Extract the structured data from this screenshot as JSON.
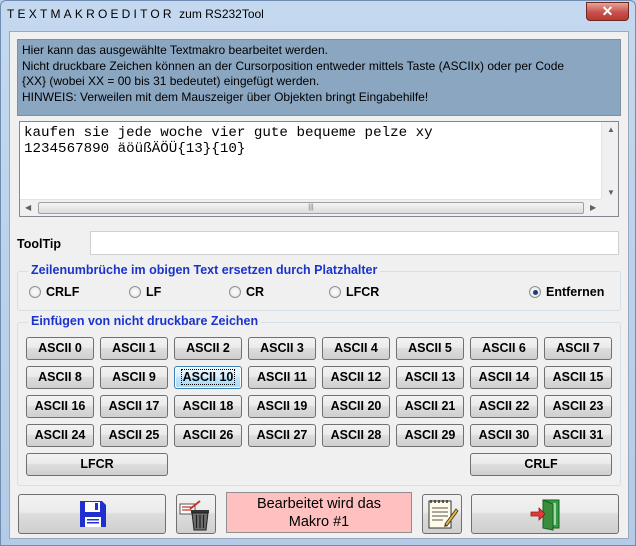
{
  "window": {
    "title_main": "TEXTMAKROEDITOR",
    "title_suffix": "zum RS232Tool",
    "close_label": "✕"
  },
  "info": {
    "lines": [
      "Hier kann das ausgewählte Textmakro bearbeitet werden.",
      "Nicht druckbare Zeichen können an der Cursorposition entweder mittels Taste (ASCIIx) oder per Code",
      "{XX} (wobei XX = 00 bis 31 bedeutet) eingefügt werden.",
      "HINWEIS: Verweilen mit dem Mauszeiger über Objekten bringt Eingabehilfe!"
    ]
  },
  "editor": {
    "line1": "kaufen sie jede woche vier gute bequeme pelze xy",
    "line2": "1234567890 äöüßÄÖÜ{13}{10}"
  },
  "tooltip": {
    "label": "ToolTip",
    "value": ""
  },
  "linebreaks": {
    "title": "Zeilenumbrüche im obigen Text ersetzen durch Platzhalter",
    "options": [
      "CRLF",
      "LF",
      "CR",
      "LFCR",
      "Entfernen"
    ],
    "selected": "Entfernen"
  },
  "insert": {
    "title": "Einfügen von nicht druckbare Zeichen",
    "buttons": [
      "ASCII 0",
      "ASCII 1",
      "ASCII 2",
      "ASCII 3",
      "ASCII 4",
      "ASCII 5",
      "ASCII 6",
      "ASCII 7",
      "ASCII 8",
      "ASCII 9",
      "ASCII 10",
      "ASCII 11",
      "ASCII 12",
      "ASCII 13",
      "ASCII 14",
      "ASCII 15",
      "ASCII 16",
      "ASCII 17",
      "ASCII 18",
      "ASCII 19",
      "ASCII 20",
      "ASCII 21",
      "ASCII 22",
      "ASCII 23",
      "ASCII 24",
      "ASCII 25",
      "ASCII 26",
      "ASCII 27",
      "ASCII 28",
      "ASCII 29",
      "ASCII 30",
      "ASCII 31"
    ],
    "focused": "ASCII 10",
    "lfcr_label": "LFCR",
    "crlf_label": "CRLF"
  },
  "bottom": {
    "status_line1": "Bearbeitet wird das",
    "status_line2": "Makro #1",
    "icons": [
      "save-icon",
      "delete-icon",
      "notepad-icon",
      "exit-icon"
    ]
  }
}
